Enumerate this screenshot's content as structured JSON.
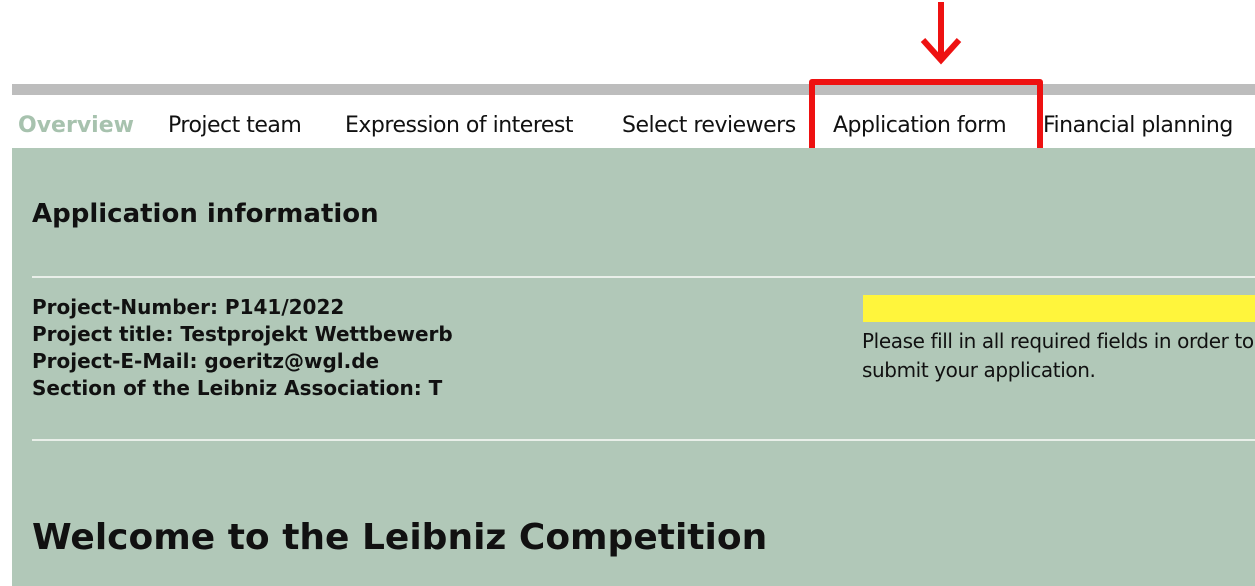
{
  "tabs": [
    {
      "label": "Overview",
      "active": true
    },
    {
      "label": "Project team",
      "active": false
    },
    {
      "label": "Expression of interest",
      "active": false
    },
    {
      "label": "Select reviewers",
      "active": false
    },
    {
      "label": "Application form",
      "active": false,
      "highlighted": true
    },
    {
      "label": "Financial planning",
      "active": false
    }
  ],
  "application_info": {
    "title": "Application information",
    "lines": [
      "Project-Number: P141/2022",
      "Project title: Testprojekt Wettbewerb",
      "Project-E-Mail: goeritz@wgl.de",
      "Section of the Leibniz Association: T"
    ]
  },
  "status": {
    "message": "Please fill in all required fields in order to submit your application.",
    "bar_color": "#fff53c"
  },
  "welcome": {
    "heading": "Welcome to the Leibniz Competition"
  },
  "colors": {
    "panel_bg": "#b1c8b8",
    "active_tab": "#a7c2ae",
    "highlight": "#ee1111",
    "top_rule": "#bdbdbd"
  },
  "annotation": {
    "arrow_icon": "arrow-down-icon",
    "highlight_target": "Application form"
  }
}
